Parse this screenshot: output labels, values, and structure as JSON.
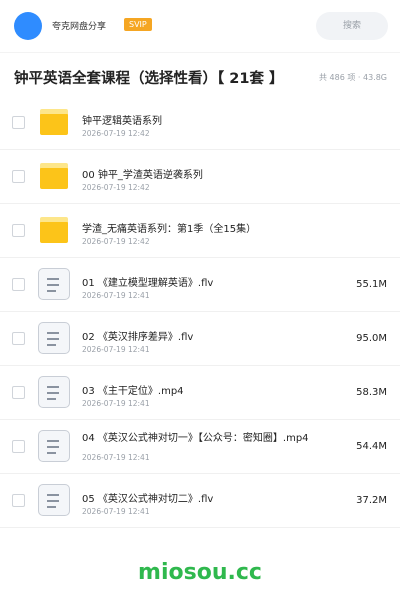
{
  "header": {
    "share_name": "夸克网盘分享",
    "badge": "SVIP",
    "search_placeholder": "搜索",
    "accent_color": "#2f8cff",
    "badge_color": "#f5a623"
  },
  "title": "钟平英语全套课程（选择性看）【 21套 】",
  "meta": "共 486 项 · 43.8G",
  "files": [
    {
      "type": "folder",
      "icon": "folder-icon",
      "name": "钟平逻辑英语系列",
      "date": "2026-07-19 12:42",
      "size": ""
    },
    {
      "type": "folder",
      "icon": "folder-icon",
      "name": "00 钟平_学渣英语逆袭系列",
      "date": "2026-07-19 12:42",
      "size": ""
    },
    {
      "type": "folder",
      "icon": "folder-icon",
      "name": "学渣_无痛英语系列：第1季（全15集）",
      "date": "2026-07-19 12:42",
      "size": ""
    },
    {
      "type": "video",
      "icon": "video-file-icon",
      "name": "01 《建立模型理解英语》.flv",
      "date": "2026-07-19 12:41",
      "size": "55.1M"
    },
    {
      "type": "video",
      "icon": "video-file-icon",
      "name": "02 《英汉排序差异》.flv",
      "date": "2026-07-19 12:41",
      "size": "95.0M"
    },
    {
      "type": "video",
      "icon": "video-file-icon",
      "name": "03 《主干定位》.mp4",
      "date": "2026-07-19 12:41",
      "size": "58.3M"
    },
    {
      "type": "video",
      "icon": "video-file-icon",
      "name": "04 《英汉公式神对切一》【公众号：密知圈】.mp4",
      "date": "2026-07-19 12:41",
      "size": "54.4M"
    },
    {
      "type": "video",
      "icon": "video-file-icon",
      "name": "05 《英汉公式神对切二》.flv",
      "date": "2026-07-19 12:41",
      "size": "37.2M"
    }
  ],
  "watermark": "miosou.cc",
  "watermark_color": "#2fb84d"
}
